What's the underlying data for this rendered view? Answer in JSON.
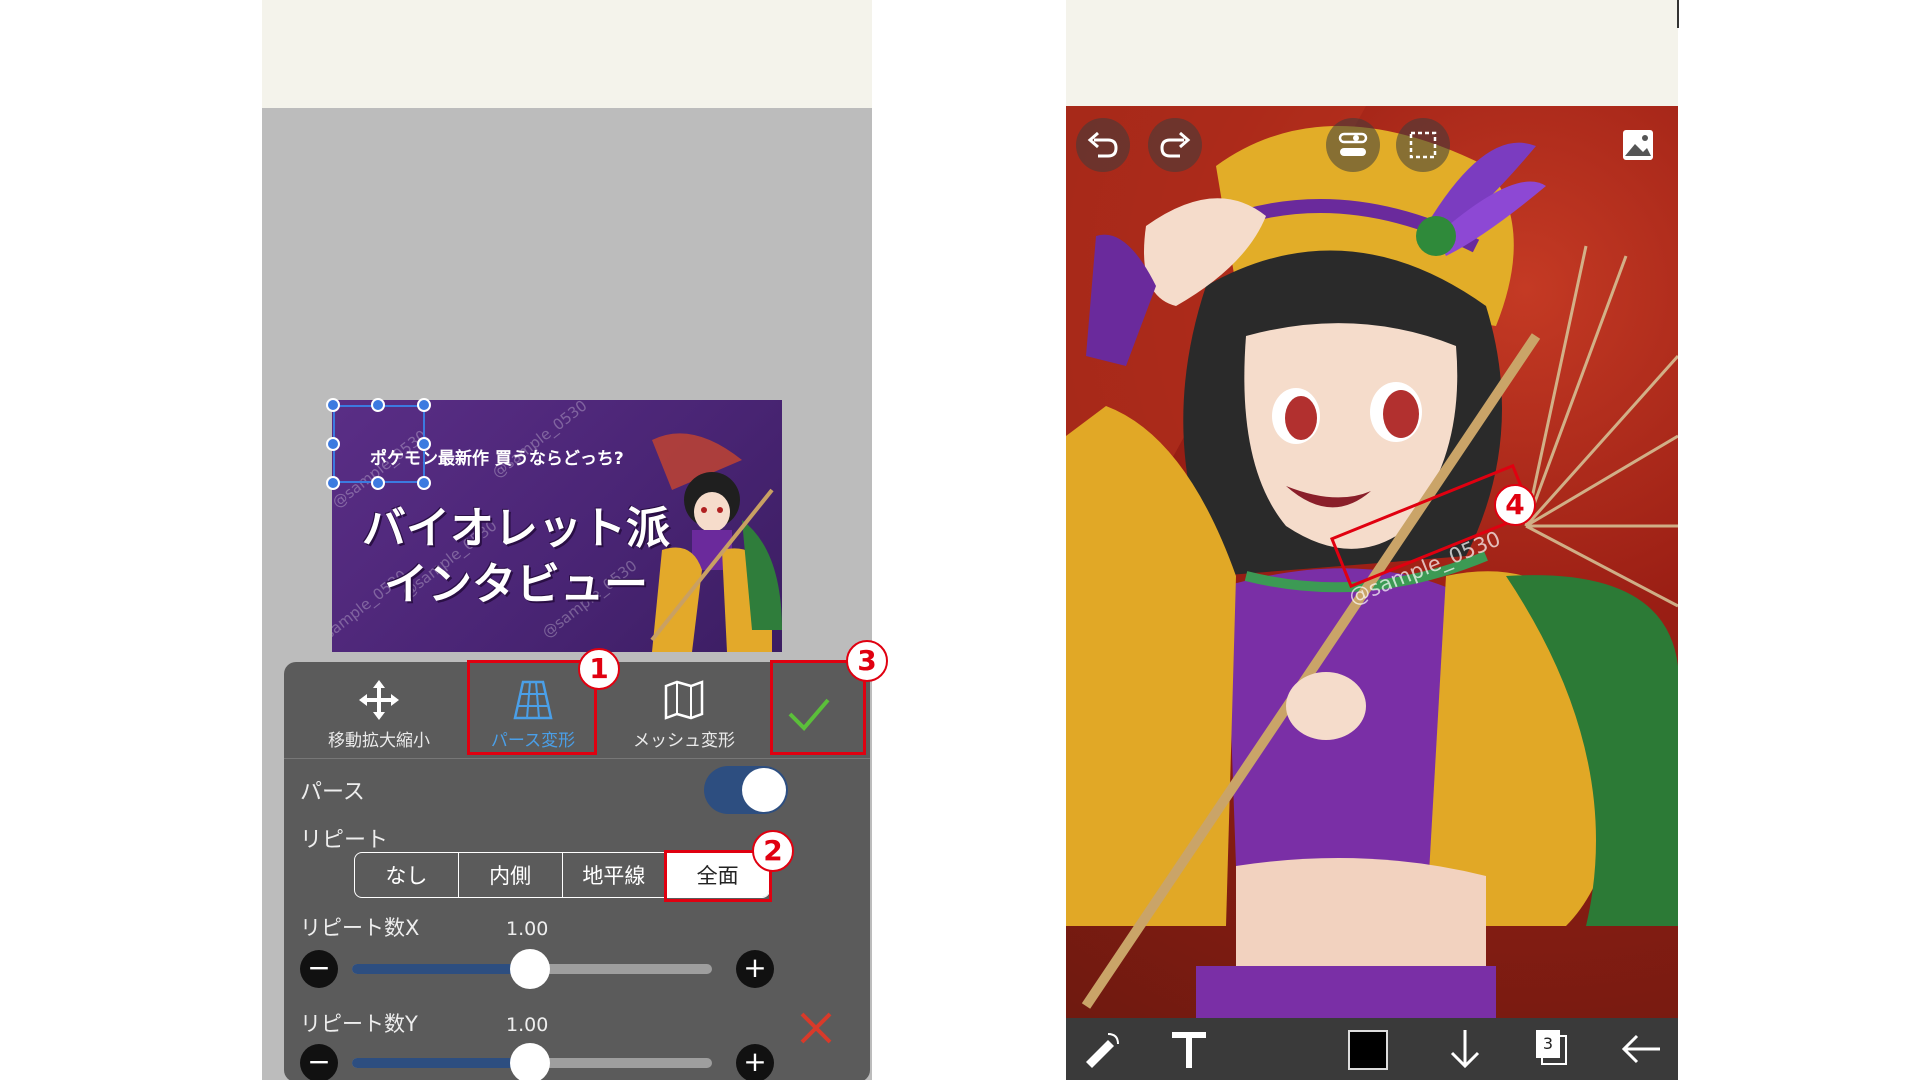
{
  "thumbnail": {
    "subtitle": "ポケモン最新作 買うならどっち?",
    "title_line1": "バイオレット派",
    "title_line2": "インタビュー",
    "watermark": "@sample_0530"
  },
  "transform_tools": [
    {
      "label": "移動拡大縮小",
      "icon": "move-arrows-icon",
      "selected": false
    },
    {
      "label": "パース変形",
      "icon": "perspective-grid-icon",
      "selected": true
    },
    {
      "label": "メッシュ変形",
      "icon": "mesh-map-icon",
      "selected": false
    }
  ],
  "confirm": {
    "icon": "checkmark-icon"
  },
  "cancel": {
    "icon": "close-icon"
  },
  "perspective": {
    "label": "パース",
    "enabled": true
  },
  "repeat": {
    "label": "リピート",
    "options": [
      "なし",
      "内側",
      "地平線",
      "全面"
    ],
    "selected": "全面"
  },
  "repeat_x": {
    "label": "リピート数X",
    "value": "1.00",
    "level": 0.5
  },
  "repeat_y": {
    "label": "リピート数Y",
    "value": "1.00",
    "level": 0.5
  },
  "annotations": [
    "1",
    "2",
    "3",
    "4"
  ],
  "canvas": {
    "watermark": "@sample_0530",
    "layer_count": "3"
  },
  "colors": {
    "accent_blue": "#4a9fe8",
    "toggle_blue": "#2d4e80",
    "confirm_green": "#5bbf3a",
    "cancel_red": "#d83a2a",
    "annotation_red": "#e00010"
  }
}
